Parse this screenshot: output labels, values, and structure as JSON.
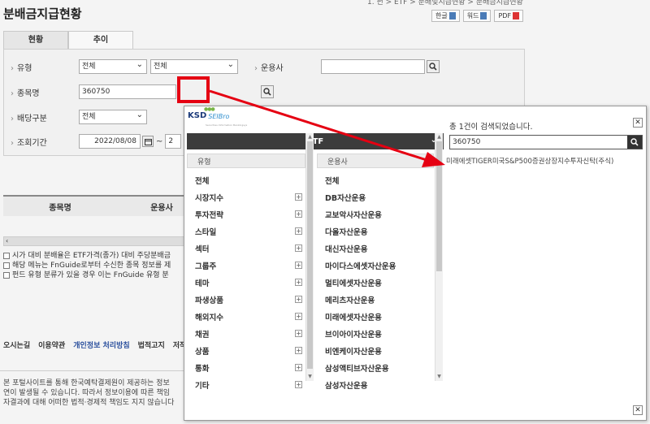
{
  "page": {
    "title": "분배금지급현황",
    "breadcrumb": "1. 펀 > ETF > 분배및지급현황 > 분배금지급현황",
    "doc_buttons": [
      "한글",
      "워드",
      "PDF"
    ]
  },
  "tabs": [
    "현황",
    "추이"
  ],
  "filters": {
    "type_label": "유형",
    "type_select1": "전체",
    "type_select2": "전체",
    "manager_label": "운용사",
    "manager_value": "",
    "item_label": "종목명",
    "item_value": "360750",
    "dist_label": "배당구분",
    "dist_select": "전체",
    "period_label": "조회기간",
    "period_from": "2022/08/08",
    "period_to": "2"
  },
  "grid": {
    "headers": [
      "종목명",
      "운용사"
    ]
  },
  "notes": [
    "시가 대비 분배율은 ETF가격(종가) 대비 주당분배금",
    "해당 메뉴는 FnGuide로부터 수신한 종목 정보를 제",
    "펀드 유형 분류가 있을 경우 이는 FnGuide 유형 분"
  ],
  "footer": {
    "links": [
      "오시는길",
      "이용약관",
      "개인정보 처리방침",
      "법적고지",
      "저작"
    ],
    "lines": [
      "본 포털사이트를 통해 한국예탁결제원이 제공하는 정보",
      "연이 발생될 수 있습니다. 따라서 정보이용에 따른 책임",
      "자결과에 대해 어떠한 법적·경제적 책임도 지지 않습니다"
    ]
  },
  "popup": {
    "logo_main": "KSD",
    "logo_sub": "SEIBro",
    "logo_tagline": "Securities Information Bankingsys",
    "category": "ETF",
    "type_header": "유형",
    "manager_header": "운용사",
    "types": [
      "전체",
      "시장지수",
      "투자전략",
      "스타일",
      "섹터",
      "그룹주",
      "테마",
      "파생상품",
      "해외지수",
      "채권",
      "상품",
      "통화",
      "기타"
    ],
    "managers": [
      "전체",
      "DB자산운용",
      "교보악사자산운용",
      "다올자산운용",
      "대신자산운용",
      "마이다스에셋자산운용",
      "멀티에셋자산운용",
      "메리츠자산운용",
      "미래에셋자산운용",
      "브이아이자산운용",
      "비엔케이자산운용",
      "삼성액티브자산운용",
      "삼성자산운용"
    ],
    "count_text": "총 1건이 검색되었습니다.",
    "search_value": "360750",
    "result": "미래에셋TIGER미국S&P500증권상장지수투자신탁(주식)"
  },
  "colors": {
    "highlight": "#e50012",
    "dark_bar": "#3c3c3c"
  }
}
